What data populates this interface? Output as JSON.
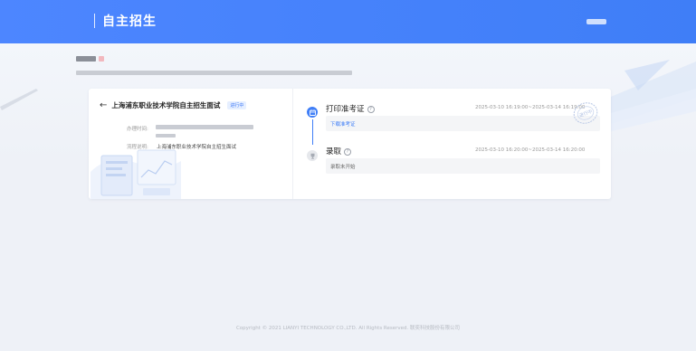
{
  "header": {
    "title": "自主招生"
  },
  "card": {
    "school_title": "上海浦东职业技术学院自主招生面试",
    "status_tag": "进行中",
    "handle_time_label": "办理时间:",
    "process_desc_label": "流程说明:",
    "process_desc_value": "上海浦东职业技术学院自主招生面试"
  },
  "steps": [
    {
      "title": "打印准考证",
      "time": "2025-03-10 16:19:00~2025-03-14 16:19:00",
      "action": "下载准考证",
      "stamp_text": "进行中"
    },
    {
      "title": "录取",
      "time": "2025-03-10 16:20:00~2025-03-14 16:20:00",
      "status": "录取未开始"
    }
  ],
  "footer": {
    "copyright": "Copyright © 2021 LIANYI TECHNOLOGY CO.,LTD. All Rights Reserved. 联奕科技股份有限公司"
  },
  "colors": {
    "primary": "#3f7ef7",
    "page_bg": "#eef1f7"
  },
  "icons": {
    "back": "arrow-left-icon",
    "step1": "calendar-icon",
    "step2": "trophy-icon",
    "help": "question-circle-icon"
  }
}
